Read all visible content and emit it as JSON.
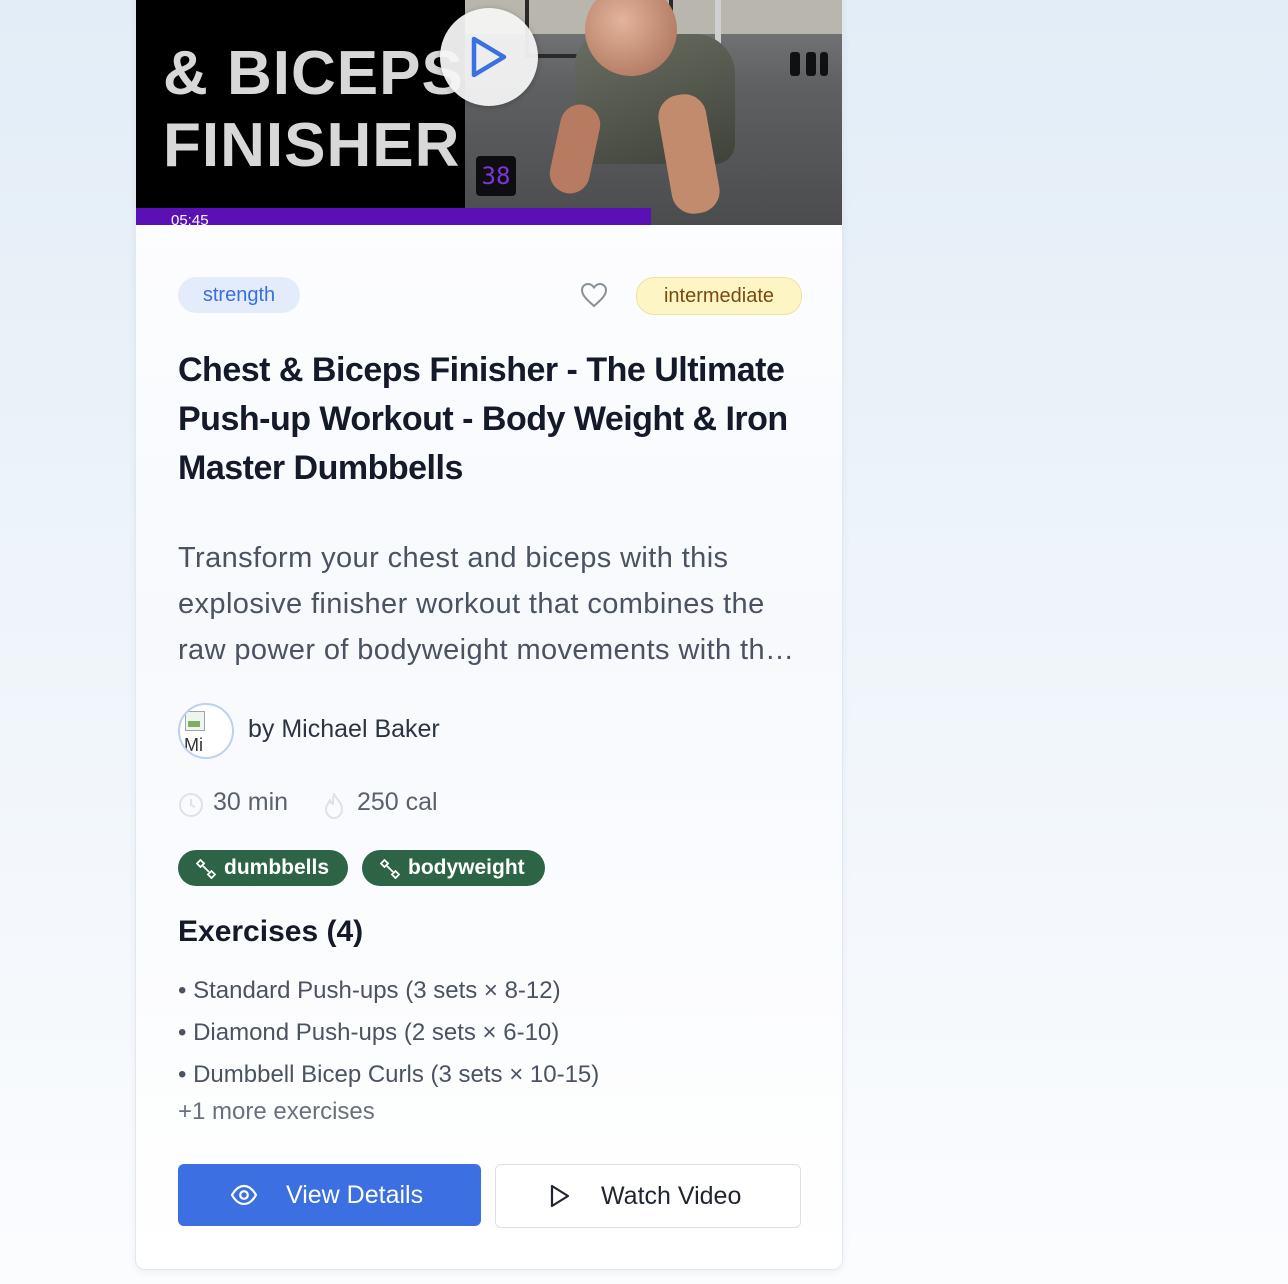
{
  "video": {
    "thumbnail_title": "& BICEPS\nFINISHER",
    "counter": "38",
    "time": "05:45",
    "progress": 0.73,
    "accent_color": "#5b10b5"
  },
  "card": {
    "category": "strength",
    "level": "intermediate",
    "title": "Chest & Biceps Finisher - The Ultimate Push-up Workout - Body Weight & Iron Master Dumbbells",
    "description": "Transform your chest and biceps with this explosive finisher workout that combines the raw power of bodyweight movements with the versatility of Iron Master Dumbbells.",
    "avatar_alt": "Mi",
    "author": "by Michael Baker",
    "duration": "30 min",
    "calories": "250 cal",
    "equipment": [
      "dumbbells",
      "bodyweight"
    ],
    "exercises_heading": "Exercises (4)",
    "exercises": [
      "Standard Push-ups (3 sets × 8-12)",
      "Diamond Push-ups (2 sets × 6-10)",
      "Dumbbell Bicep Curls (3 sets × 10-15)"
    ],
    "more_exercises": "+1 more exercises",
    "view_details_label": "View Details",
    "watch_video_label": "Watch Video"
  },
  "icons": {
    "favorite": "heart-icon",
    "play": "play-icon",
    "clock": "clock-icon",
    "calories": "flame-icon",
    "equipment": "dumbbell-icon",
    "view": "eye-icon"
  },
  "colors": {
    "primary": "#3b6fe2",
    "equipment_tag": "#2c6445",
    "strength_badge_bg": "#e4ecfb",
    "level_badge_bg": "#fdf5c4"
  }
}
